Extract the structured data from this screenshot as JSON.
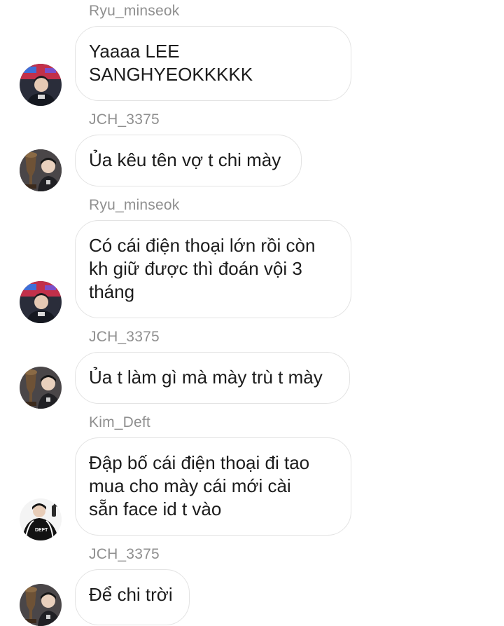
{
  "messages": [
    {
      "sender": "Ryu_minseok",
      "text": "Yaaaa LEE\nSANGHYEOKKKKK",
      "avatar": "ryu-avatar-icon"
    },
    {
      "sender": "JCH_3375",
      "text": "Ủa kêu tên vợ t chi mày",
      "avatar": "trophy-avatar-icon"
    },
    {
      "sender": "Ryu_minseok",
      "text": "Có cái điện thoại lớn rồi còn\nkh giữ được thì đoán vội 3\ntháng",
      "avatar": "ryu-avatar-icon"
    },
    {
      "sender": "JCH_3375",
      "text": "Ủa t làm gì mà mày trù t mày",
      "avatar": "trophy-avatar-icon"
    },
    {
      "sender": "Kim_Deft",
      "text": "Đập bố cái điện thoại đi tao\nmua cho mày cái mới cài\nsẵn face id t vào",
      "avatar": "deft-avatar-icon",
      "avatar_text": "DEFT"
    },
    {
      "sender": "JCH_3375",
      "text": "Để chi trời",
      "avatar": "trophy-avatar-icon"
    }
  ],
  "colors": {
    "sender_name": "#8f8f8f",
    "bubble_border": "#e3e3e3",
    "message_text": "#1c1c1c",
    "background": "#ffffff"
  }
}
